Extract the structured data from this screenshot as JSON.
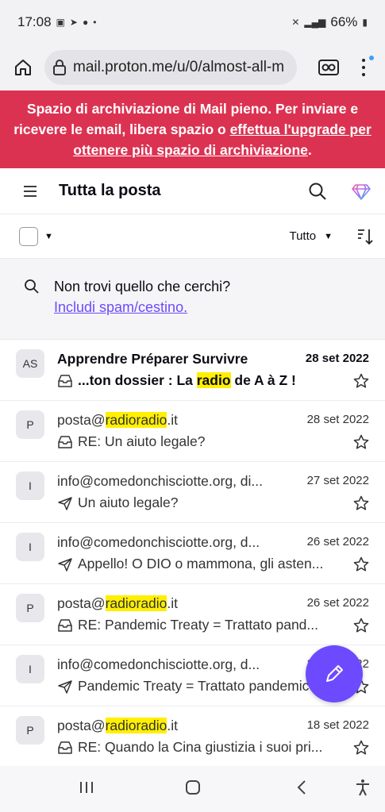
{
  "status": {
    "time": "17:08",
    "battery": "66%"
  },
  "browser": {
    "url": "mail.proton.me/u/0/almost-all-m"
  },
  "banner": {
    "text_before": "Spazio di archiviazione di Mail pieno. Per inviare e ricevere le email, libera spazio o ",
    "link": "effettua l'upgrade per ottenere più spazio di archiviazione",
    "text_after": "."
  },
  "header": {
    "title": "Tutta la posta"
  },
  "toolbar": {
    "filter_label": "Tutto"
  },
  "notfound": {
    "question": "Non trovi quello che cerchi?",
    "link": "Includi spam/cestino."
  },
  "emails": [
    {
      "avatar": "AS",
      "from": "Apprendre Préparer Survivre",
      "from_hl": "",
      "from_post": "",
      "date": "28 set 2022",
      "subj_pre": "...ton dossier : La ",
      "subj_hl": "radio",
      "subj_post": " de A à Z !",
      "type": "received",
      "unread": true
    },
    {
      "avatar": "P",
      "from": "posta@",
      "from_hl": "radioradio",
      "from_post": ".it",
      "date": "28 set 2022",
      "subj_pre": "RE: Un aiuto legale?",
      "subj_hl": "",
      "subj_post": "",
      "type": "received",
      "unread": false
    },
    {
      "avatar": "I",
      "from": "info@comedonchisciotte.org, di...",
      "from_hl": "",
      "from_post": "",
      "date": "27 set 2022",
      "subj_pre": "Un aiuto legale?",
      "subj_hl": "",
      "subj_post": "",
      "type": "sent",
      "unread": false
    },
    {
      "avatar": "I",
      "from": "info@comedonchisciotte.org, d...",
      "from_hl": "",
      "from_post": "",
      "date": "26 set 2022",
      "subj_pre": "Appello! O DIO o mammona, gli asten...",
      "subj_hl": "",
      "subj_post": "",
      "type": "sent",
      "unread": false
    },
    {
      "avatar": "P",
      "from": "posta@",
      "from_hl": "radioradio",
      "from_post": ".it",
      "date": "26 set 2022",
      "subj_pre": "RE: Pandemic Treaty = Trattato pand...",
      "subj_hl": "",
      "subj_post": "",
      "type": "received",
      "unread": false
    },
    {
      "avatar": "I",
      "from": "info@comedonchisciotte.org, d...",
      "from_hl": "",
      "from_post": "",
      "date": "26 set 2022",
      "subj_pre": "Pandemic Treaty = Trattato pandemico",
      "subj_hl": "",
      "subj_post": "",
      "type": "sent",
      "unread": false
    },
    {
      "avatar": "P",
      "from": "posta@",
      "from_hl": "radioradio",
      "from_post": ".it",
      "date": "18 set 2022",
      "subj_pre": "RE: Quando la Cina giustizia i suoi pri...",
      "subj_hl": "",
      "subj_post": "",
      "type": "received",
      "unread": false
    }
  ],
  "colors": {
    "brand": "#6d4aff",
    "banner": "#dc3251",
    "highlight": "#ffef00"
  }
}
